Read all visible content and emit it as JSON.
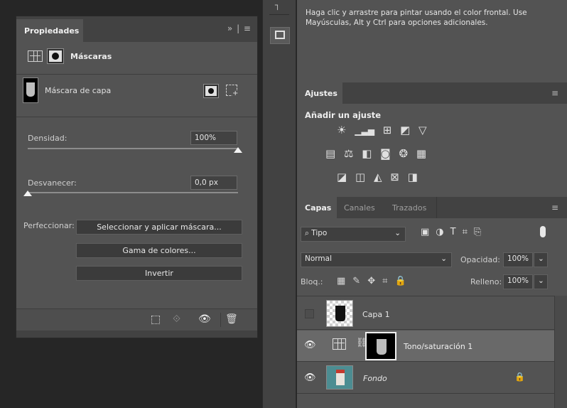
{
  "properties": {
    "tab_label": "Propiedades",
    "menu_glyph": "»  |  ≡",
    "section_title": "Máscaras",
    "mask_label": "Máscara de capa",
    "density_label": "Densidad:",
    "density_value": "100%",
    "density_fraction": 1.0,
    "feather_label": "Desvanecer:",
    "feather_value": "0,0 px",
    "feather_fraction": 0.0,
    "refine_label": "Perfeccionar:",
    "select_mask_button": "Seleccionar y aplicar máscara...",
    "color_range_button": "Gama de colores...",
    "invert_button": "Invertir"
  },
  "tooltip": {
    "text": "Haga clic y arrastre para pintar usando el color frontal. Use Mayúsculas, Alt y Ctrl para opciones adicionales."
  },
  "adjustments": {
    "tab_label": "Ajustes",
    "heading": "Añadir un ajuste"
  },
  "layers_panel": {
    "tabs": [
      {
        "label": "Capas"
      },
      {
        "label": "Canales"
      },
      {
        "label": "Trazados"
      }
    ],
    "filter_kind": "Tipo",
    "blend_mode": "Normal",
    "opacity_label": "Opacidad:",
    "opacity_value": "100%",
    "lock_label": "Bloq.:",
    "fill_label": "Relleno:",
    "fill_value": "100%",
    "layers": [
      {
        "name": "Capa 1"
      },
      {
        "name": "Tono/saturación 1"
      },
      {
        "name": "Fondo"
      }
    ]
  },
  "colors": {
    "panel_bg": "#535353",
    "dark_bg": "#262626",
    "tab_bar": "#424242",
    "selected_row": "#696969"
  }
}
